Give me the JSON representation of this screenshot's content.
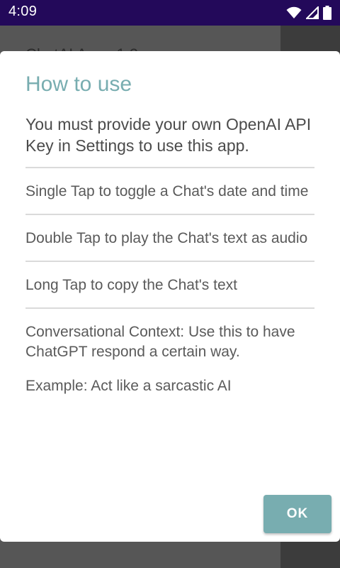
{
  "status_bar": {
    "time": "4:09",
    "icons": [
      "wifi-icon",
      "signal-icon",
      "battery-icon"
    ]
  },
  "background": {
    "partial_title": "ChatAI App v1.2"
  },
  "dialog": {
    "title": "How to use",
    "intro": "You must provide your own OpenAI API Key in Settings to use this app.",
    "tips": [
      "Single Tap to toggle a Chat's date and time",
      "Double Tap to play the Chat's text as audio",
      "Long Tap to copy the Chat's text"
    ],
    "context_text": "Conversational Context: Use this to have ChatGPT respond a certain way.",
    "example_text": "Example: Act like a sarcastic AI",
    "ok_label": "OK"
  },
  "colors": {
    "status_bar": "#23095a",
    "accent": "#78adb0",
    "scrim": "#565656"
  }
}
